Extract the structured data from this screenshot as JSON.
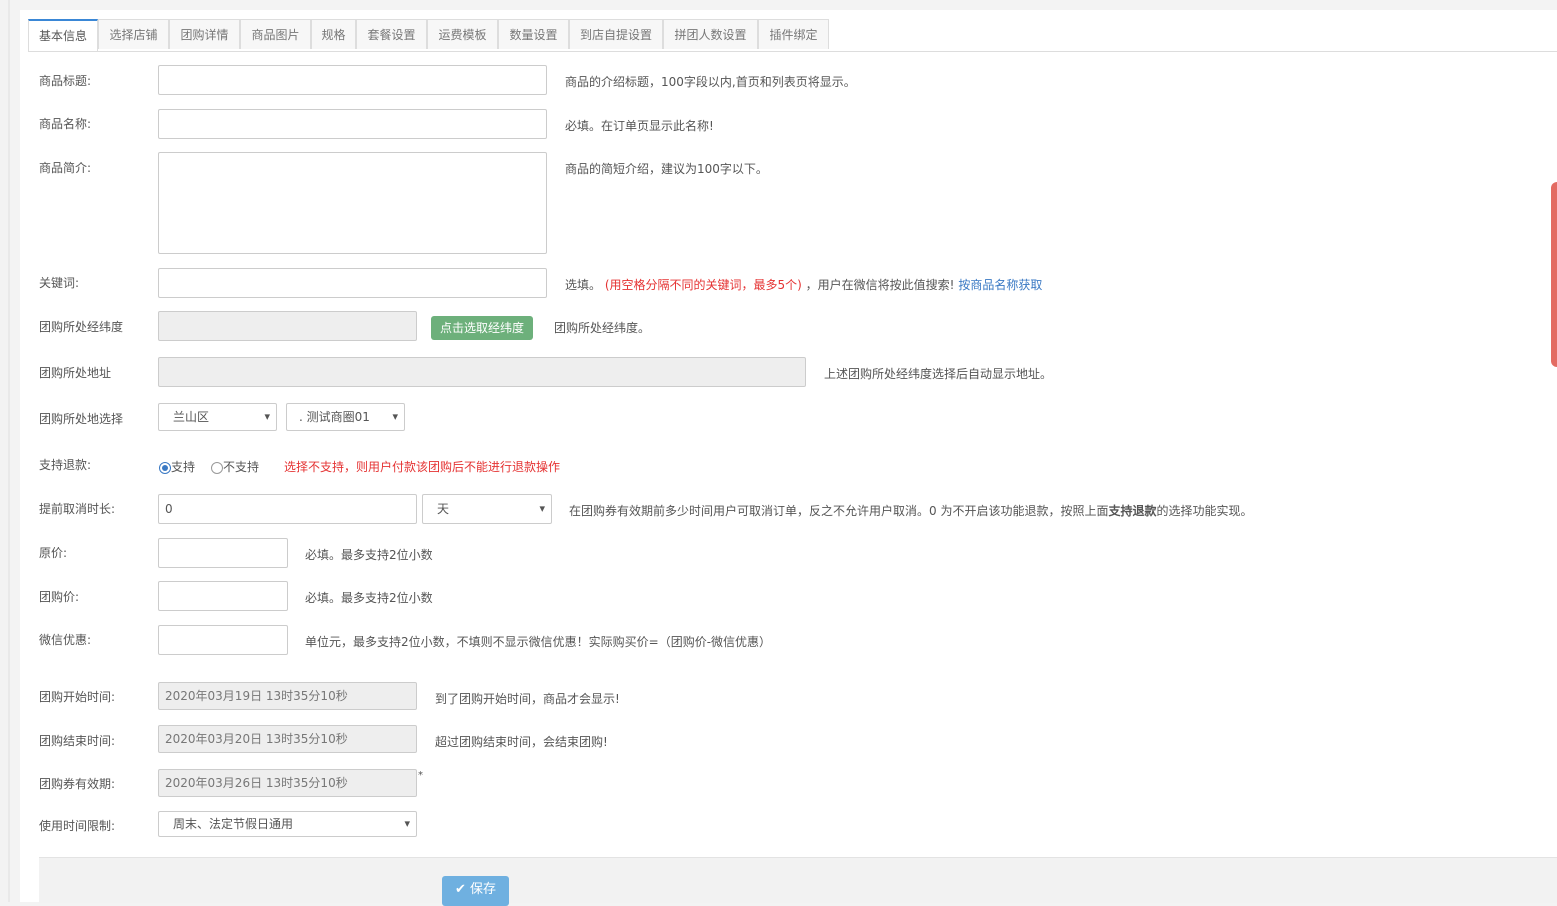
{
  "tabs": [
    "基本信息",
    "选择店铺",
    "团购详情",
    "商品图片",
    "规格",
    "套餐设置",
    "运费模板",
    "数量设置",
    "到店自提设置",
    "拼团人数设置",
    "插件绑定"
  ],
  "fields": {
    "title": {
      "label": "商品标题:",
      "hint": "商品的介绍标题，100字段以内,首页和列表页将显示。"
    },
    "name": {
      "label": "商品名称:",
      "hint": "必填。在订单页显示此名称!"
    },
    "intro": {
      "label": "商品简介:",
      "hint": "商品的简短介绍，建议为100字以下。"
    },
    "keywords": {
      "label": "关键词:",
      "hint_a": "选填。",
      "hint_red": "(用空格分隔不同的关键词，最多5个)",
      "hint_b": "，用户在微信将按此值搜索!",
      "hint_link": "按商品名称获取"
    },
    "latlng": {
      "label": "团购所处经纬度",
      "button": "点击选取经纬度",
      "hint": "团购所处经纬度。"
    },
    "address": {
      "label": "团购所处地址",
      "hint": "上述团购所处经纬度选择后自动显示地址。"
    },
    "location_select": {
      "label": "团购所处地选择",
      "district": "兰山区",
      "area": "测试商圈01"
    },
    "refund": {
      "label": "支持退款:",
      "opt_yes": "支持",
      "opt_no": "不支持",
      "hint": "选择不支持，则用户付款该团购后不能进行退款操作"
    },
    "cancel": {
      "label": "提前取消时长:",
      "value": "0",
      "unit": "天",
      "hint_a": "在团购券有效期前多少时间用户可取消订单，反之不允许用户取消。0 为不开启该功能退款，按照上面",
      "hint_bold": "支持退款",
      "hint_b": "的选择功能实现。"
    },
    "orig_price": {
      "label": "原价:",
      "hint": "必填。最多支持2位小数"
    },
    "group_price": {
      "label": "团购价:",
      "hint": "必填。最多支持2位小数"
    },
    "wx_discount": {
      "label": "微信优惠:",
      "hint": "单位元，最多支持2位小数，不填则不显示微信优惠！实际购买价=（团购价-微信优惠）"
    },
    "start_time": {
      "label": "团购开始时间:",
      "value": "2020年03月19日 13时35分10秒",
      "hint": "到了团购开始时间，商品才会显示!"
    },
    "end_time": {
      "label": "团购结束时间:",
      "value": "2020年03月20日 13时35分10秒",
      "hint": "超过团购结束时间，会结束团购!"
    },
    "valid_time": {
      "label": "团购券有效期:",
      "value": "2020年03月26日 13时35分10秒",
      "mark": "*"
    },
    "use_limit": {
      "label": "使用时间限制:",
      "value": "周末、法定节假日通用"
    }
  },
  "save_label": "保存"
}
